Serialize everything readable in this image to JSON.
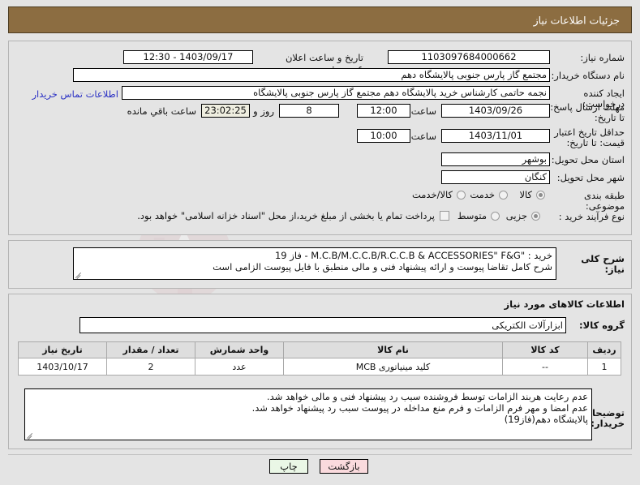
{
  "header": {
    "title": "جزئیات اطلاعات نیاز"
  },
  "main": {
    "need_number_label": "شماره نیاز:",
    "need_number_value": "1103097684000662",
    "public_announce_label": "تاریخ و ساعت اعلان عمومی:",
    "public_announce_value": "1403/09/17 - 12:30",
    "buyer_org_label": "نام دستگاه خریدار:",
    "buyer_org_value": "مجتمع گاز پارس جنوبی  پالایشگاه دهم",
    "requester_label": "ایجاد کننده درخواست:",
    "requester_value": "نجمه حاتمی کارشناس خرید پالایشگاه دهم  مجتمع گاز پارس جنوبی  پالایشگاه",
    "contact_link": "اطلاعات تماس خریدار",
    "deadline_label": "مهلت ارسال پاسخ: تا تاریخ:",
    "deadline_date": "1403/09/26",
    "deadline_hour_label": "ساعت",
    "deadline_hour": "12:00",
    "remaining_days": "8",
    "remaining_days_label": "روز و",
    "remaining_time": "23:02:25",
    "remaining_suffix": "ساعت باقي مانده",
    "price_validity_label": "حداقل تاریخ اعتبار قیمت: تا تاریخ:",
    "price_validity_date": "1403/11/01",
    "price_validity_hour_label": "ساعت",
    "price_validity_hour": "10:00",
    "province_label": "استان محل تحویل:",
    "province_value": "بوشهر",
    "city_label": "شهر محل تحویل:",
    "city_value": "کنگان",
    "category_label": "طبقه بندی موضوعی:",
    "category_options": [
      "کالا",
      "خدمت",
      "کالا/خدمت"
    ],
    "category_selected": "کالا",
    "process_type_label": "نوع فرآیند خرید :",
    "process_options": [
      "جزیی",
      "متوسط"
    ],
    "process_selected": "جزیی",
    "treasury_checkbox_label": "پرداخت تمام یا بخشی از مبلغ خرید،از محل \"اسناد خزانه اسلامی\" خواهد بود.",
    "treasury_checked": false
  },
  "description": {
    "label": "شرح کلی نیاز:",
    "line1": "خرید : \"M.C.B/M.C.C.B/R.C.C.B & ACCESSORIES\" F&G - فاز 19",
    "line2": "شرح کامل تقاضا پیوست و ارائه پیشنهاد فنی و مالی منطبق با فایل پیوست الزامی است"
  },
  "goods": {
    "section_title": "اطلاعات کالاهای مورد نیاز",
    "group_label": "گروه کالا:",
    "group_value": "ابزارآلات الکتریکی",
    "table": {
      "headers": [
        "ردیف",
        "کد کالا",
        "نام کالا",
        "واحد شمارش",
        "تعداد / مقدار",
        "تاریخ نیاز"
      ],
      "rows": [
        {
          "row": "1",
          "code": "--",
          "name": "کلید مینیاتوری MCB",
          "unit": "عدد",
          "qty": "2",
          "need_date": "1403/10/17"
        }
      ]
    },
    "notes_label": "توضیحات خریدار:",
    "notes_line1": "عدم رعایت هربند الزامات توسط فروشنده سبب رد پیشنهاد فنی و مالی خواهد شد.",
    "notes_line2": "عدم امضا و مهر فرم الزامات و فرم منع مداخله در پیوست سبب رد پیشنهاد خواهد شد.",
    "notes_line3": "پالایشگاه دهم(فاز19)"
  },
  "footer": {
    "print_label": "چاپ",
    "back_label": "بازگشت"
  },
  "colors": {
    "header_bar": "#8c6d41",
    "page_bg": "#e4e4e4",
    "link": "#2b31c4",
    "print_btn": "#eaf7e6",
    "back_btn": "#fadadd",
    "watermark": "#d9a6ad"
  },
  "watermark_text": "AriaTender.net"
}
